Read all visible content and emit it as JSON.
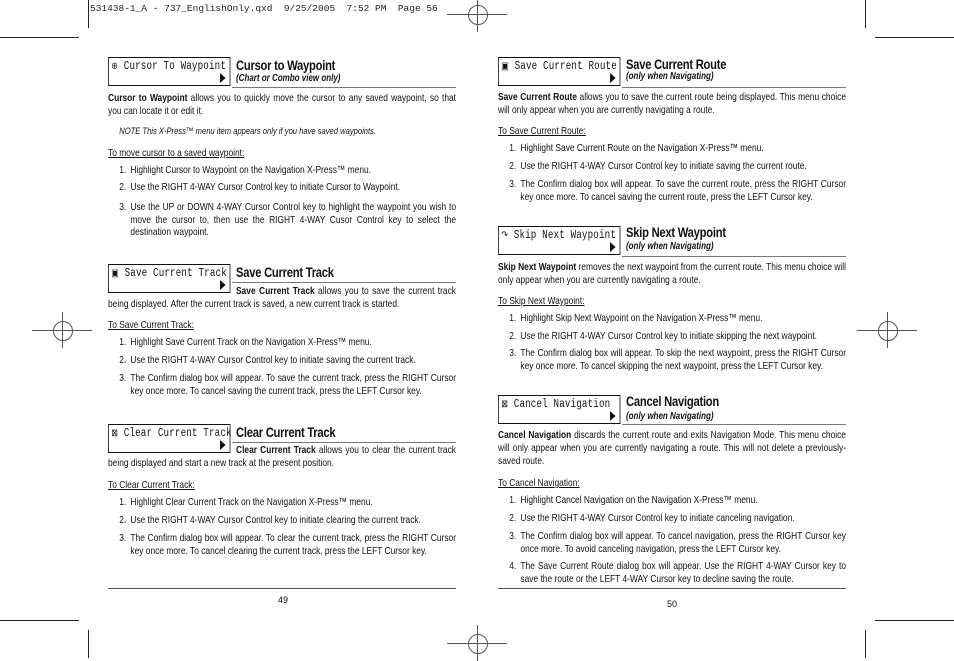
{
  "slug": "531438-1_A - 737_EnglishOnly.qxd  9/25/2005  7:52 PM  Page 56",
  "pages": [
    {
      "page_number": "49",
      "sections": [
        {
          "menu_label": "Cursor To Waypoint",
          "menu_icon": "crosshair-icon",
          "icon_glyph": "⊕",
          "title": "Cursor to Waypoint",
          "subtitle": "(Chart or Combo view only)",
          "lead": "Cursor to Waypoint",
          "body": " allows you to quickly move the cursor to any saved waypoint, so that you can locate it or edit it.",
          "note": "NOTE  This X-Press™ menu item appears only if you have saved waypoints.",
          "procedure_title": "To move cursor to a saved waypoint:",
          "steps": [
            "Highlight Cursor to Waypoint on the Navigation X-Press™ menu.",
            "Use the RIGHT 4-WAY Cursor Control key to initiate Cursor to Waypoint.",
            "Use the UP or DOWN 4-WAY Cursor Control key to highlight the waypoint you wish to move the cursor to, then use the RIGHT 4-WAY Cusor Control key to select the destination waypoint."
          ]
        },
        {
          "menu_label": "Save Current Track",
          "menu_icon": "track-icon",
          "icon_glyph": "▣",
          "title": "Save Current Track",
          "subtitle": "",
          "lead": "Save Current Track",
          "body": " allows you to save the current track being displayed. After the current track is saved, a new current track is started.",
          "procedure_title": "To Save Current Track:",
          "steps": [
            "Highlight Save Current Track on the Navigation X-Press™ menu.",
            "Use the RIGHT 4-WAY Cursor Control key to initiate saving the current track.",
            "The Confirm dialog box will appear. To save the current track,  press the RIGHT Cursor key once more. To cancel saving the current track, press the LEFT Cursor key."
          ]
        },
        {
          "menu_label": "Clear Current Track",
          "menu_icon": "clear-track-icon",
          "icon_glyph": "⊠",
          "title": "Clear Current Track",
          "subtitle": "",
          "lead": "Clear Current Track",
          "body": " allows you to clear the current track being displayed and start a new track at the present position.",
          "procedure_title": "To Clear Current Track:",
          "steps": [
            "Highlight Clear Current Track on the Navigation X-Press™ menu.",
            "Use the RIGHT 4-WAY Cursor Control key to initiate clearing the current track.",
            "The Confirm dialog box will appear. To clear the current track,  press the RIGHT Cursor key once more. To cancel clearing the current track, press the LEFT Cursor key."
          ]
        }
      ]
    },
    {
      "page_number": "50",
      "sections": [
        {
          "menu_label": "Save Current Route",
          "menu_icon": "route-icon",
          "icon_glyph": "▣",
          "title": "Save Current Route",
          "subtitle": "(only when Navigating)",
          "lead": "Save Current Route",
          "body": " allows you to save the current route being displayed. This menu choice will only appear when you are currently navigating a route.",
          "procedure_title": "To Save Current Route:",
          "steps": [
            "Highlight Save Current Route on the Navigation X-Press™ menu.",
            "Use the RIGHT 4-WAY Cursor Control key to initiate saving the current route.",
            "The Confirm dialog box will appear. To save the current route,  press the RIGHT Cursor key once more. To cancel saving the current route, press the LEFT Cursor key."
          ]
        },
        {
          "menu_label": "Skip Next Waypoint",
          "menu_icon": "skip-icon",
          "icon_glyph": "↷",
          "title": "Skip Next Waypoint",
          "subtitle": "(only when Navigating)",
          "lead": "Skip Next Waypoint",
          "body": " removes the next waypoint from the current route. This menu choice will only appear when you are currently navigating a route.",
          "procedure_title": "To Skip Next Waypoint:",
          "steps": [
            "Highlight Skip Next Waypoint on the Navigation X-Press™ menu.",
            "Use the RIGHT 4-WAY Cursor Control key to initiate skipping the next waypoint.",
            "The Confirm dialog box will appear. To skip the next waypoint,  press the RIGHT Cursor key once more. To cancel skipping the next waypoint, press the LEFT Cursor key."
          ]
        },
        {
          "menu_label": "Cancel Navigation",
          "menu_icon": "cancel-navigation-icon",
          "icon_glyph": "⊠",
          "title": "Cancel Navigation",
          "subtitle": "(only when Navigating)",
          "lead": "Cancel Navigation",
          "body": " discards the current route and exits Navigation Mode. This menu choice will only appear when you are currently navigating a route. This will not delete a previously-saved route.",
          "procedure_title": "To Cancel Navigation:",
          "steps": [
            "Highlight Cancel Navigation on the Navigation X-Press™ menu.",
            "Use the RIGHT 4-WAY Cursor Control key to initiate canceling navigation.",
            "The Confirm dialog box will appear. To cancel navigation,  press the RIGHT Cursor key once more. To avoid canceling navigation, press the LEFT Cursor key.",
            "The Save Current Route dialog box will appear. Use the RIGHT 4-WAY Cursor key to save the route or the LEFT 4-WAY Cursor key to decline saving the route."
          ]
        }
      ]
    }
  ]
}
